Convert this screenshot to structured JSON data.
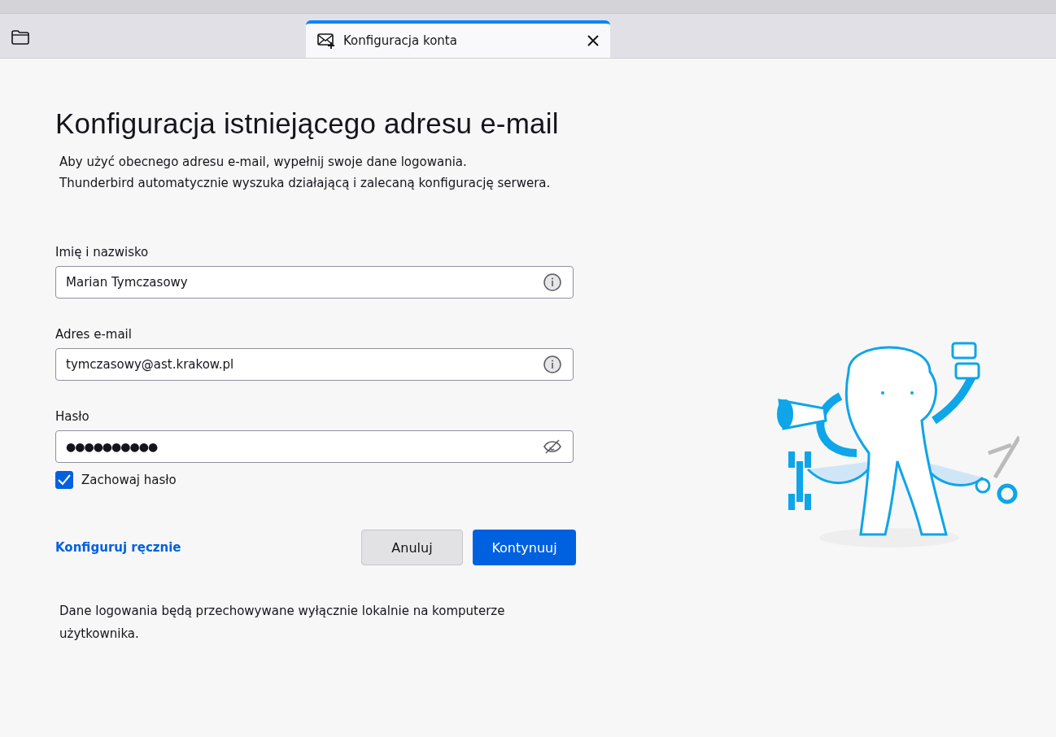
{
  "tabs": [
    {
      "title": "Konfiguracja konta",
      "selected": true
    }
  ],
  "heading": "Konfiguracja istniejącego adresu e-mail",
  "intro": [
    "Aby użyć obecnego adresu e-mail, wypełnij swoje dane logowania.",
    "Thunderbird automatycznie wyszuka działającą i zalecaną konfigurację serwera."
  ],
  "fields": [
    {
      "kind": "text",
      "label": "Imię i nazwisko",
      "value": "Marian Tymczasowy"
    },
    {
      "kind": "text",
      "label": "Adres e-mail",
      "value": "tymczasowy@ast.krakow.pl"
    },
    {
      "kind": "password",
      "label": "Hasło",
      "value": "●●●●●●●●●●"
    }
  ],
  "remember": {
    "label": "Zachowaj hasło",
    "checked": true
  },
  "manual_link": "Konfiguruj ręcznie",
  "buttons": [
    {
      "kind": "secondary",
      "label": "Anuluj"
    },
    {
      "kind": "primary",
      "label": "Kontynuuj"
    }
  ],
  "footnote": "Dane logowania będą przechowywane wyłącznie lokalnie na komputerze użytkownika."
}
